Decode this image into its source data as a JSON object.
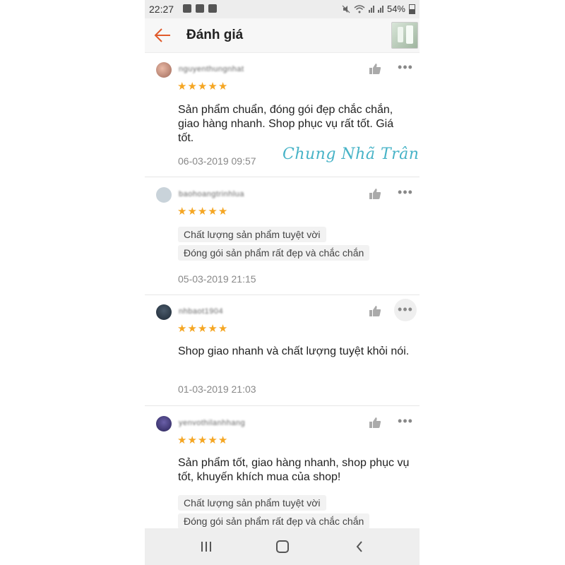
{
  "status_bar": {
    "time": "22:27",
    "battery": "54%"
  },
  "header": {
    "title": "Đánh giá"
  },
  "reviews": [
    {
      "username": "nguyenthungnhat",
      "rating": 5,
      "comment": "Sản phẩm chuẩn, đóng gói đẹp chắc chắn, giao hàng nhanh. Shop phục vụ rất tốt. Giá tốt.",
      "tags": [],
      "date": "06-03-2019 09:57"
    },
    {
      "username": "baohoangtrinhlua",
      "rating": 5,
      "comment": "",
      "tags": [
        "Chất lượng sản phẩm tuyệt vời",
        "Đóng gói sản phẩm rất đẹp và chắc chắn"
      ],
      "date": "05-03-2019 21:15"
    },
    {
      "username": "nhbaot1904",
      "rating": 5,
      "comment": "Shop giao nhanh và chất lượng tuyệt khỏi nói.",
      "tags": [],
      "date": "01-03-2019 21:03"
    },
    {
      "username": "yenvothilanhhang",
      "rating": 5,
      "comment": "Sản phẩm tốt, giao hàng nhanh, shop phục vụ tốt, khuyến khích mua của shop!",
      "tags": [
        "Chất lượng sản phẩm tuyệt vời",
        "Đóng gói sản phẩm rất đẹp và chắc chắn"
      ],
      "date": ""
    }
  ],
  "watermark": "Chung Nhã Trân",
  "colors": {
    "star": "#f5a623",
    "back_arrow": "#e05a2b",
    "watermark": "#47b3c7"
  }
}
